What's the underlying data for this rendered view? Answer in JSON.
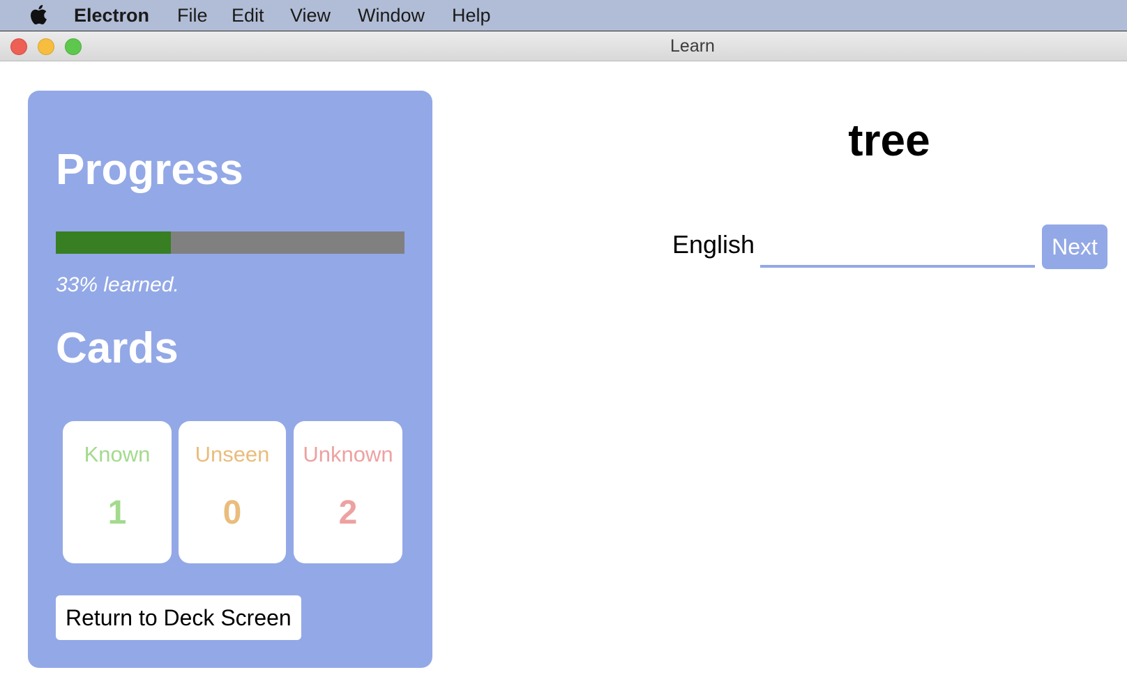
{
  "menubar": {
    "app_name": "Electron",
    "items": [
      "File",
      "Edit",
      "View",
      "Window",
      "Help"
    ]
  },
  "window": {
    "title": "Learn"
  },
  "progress": {
    "heading": "Progress",
    "fraction": 0.33,
    "text": "33% learned."
  },
  "cards": {
    "heading": "Cards",
    "known": {
      "label": "Known",
      "value": "1"
    },
    "unseen": {
      "label": "Unseen",
      "value": "0"
    },
    "unknown": {
      "label": "Unknown",
      "value": "2"
    }
  },
  "return_button": "Return to Deck Screen",
  "quiz": {
    "word": "tree",
    "language_label": "English",
    "answer_value": "",
    "next_label": "Next"
  },
  "colors": {
    "panel": "#93a8e6",
    "progress_fill": "#377f22",
    "progress_track": "#808080",
    "known": "#a3da8d",
    "unseen": "#e9bd7c",
    "unknown": "#eea1a1"
  }
}
